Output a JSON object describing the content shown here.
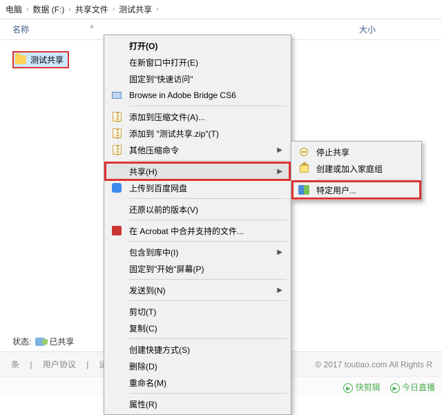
{
  "breadcrumb": {
    "c0": "电脑",
    "c1": "数据 (F:)",
    "c2": "共享文件",
    "c3": "测试共享"
  },
  "columns": {
    "name": "名称",
    "size": "大小"
  },
  "folder": {
    "label": "测试共享"
  },
  "status": {
    "label": "状态:",
    "value": "已共享"
  },
  "footer": {
    "l0": "条",
    "sep": "|",
    "l1": "用户协议",
    "l2": "运营",
    "copy": "© 2017 toutiao.com All Rights R",
    "quick_cut": "快剪辑",
    "live": "今日直播"
  },
  "menu": {
    "open": "打开(O)",
    "new_window": "在新窗口中打开(E)",
    "pin_quick": "固定到\"快速访问\"",
    "bridge": "Browse in Adobe Bridge CS6",
    "add_zip": "添加到压缩文件(A)...",
    "add_zip_named": "添加到 \"测试共享.zip\"(T)",
    "other_zip": "其他压缩命令",
    "share": "共享(H)",
    "baidu": "上传到百度网盘",
    "restore": "还原以前的版本(V)",
    "acrobat": "在 Acrobat 中合并支持的文件...",
    "include_lib": "包含到库中(I)",
    "pin_start": "固定到\"开始\"屏幕(P)",
    "send_to": "发送到(N)",
    "cut": "剪切(T)",
    "copy": "复制(C)",
    "shortcut": "创建快捷方式(S)",
    "delete": "删除(D)",
    "rename": "重命名(M)",
    "properties": "属性(R)"
  },
  "submenu": {
    "stop": "停止共享",
    "homegroup": "创建或加入家庭组",
    "specific": "特定用户..."
  }
}
